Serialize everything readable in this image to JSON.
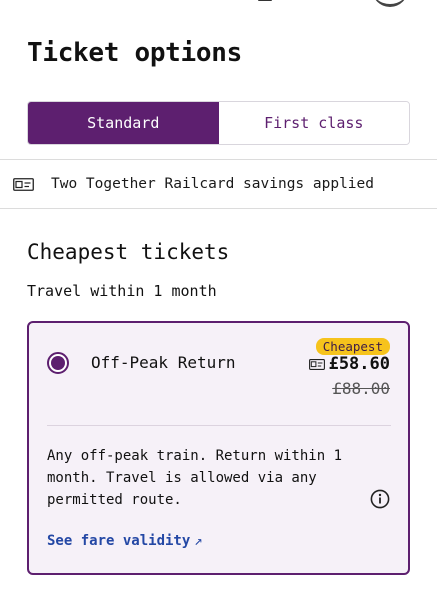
{
  "header": {
    "title": "Ticket options"
  },
  "class_toggle": {
    "options": [
      {
        "label": "Standard",
        "selected": true
      },
      {
        "label": "First class",
        "selected": false
      }
    ]
  },
  "railcard": {
    "icon": "railcard-icon",
    "text": "Two Together Railcard savings applied"
  },
  "section": {
    "title": "Cheapest tickets",
    "subtitle": "Travel within 1 month"
  },
  "ticket": {
    "selected": true,
    "name": "Off-Peak Return",
    "badge": "Cheapest",
    "price": "£58.60",
    "original_price": "£88.00",
    "description": "Any off-peak train. Return within 1 month. Travel is allowed via any permitted route.",
    "link_label": "See fare validity",
    "link_icon": "↗"
  },
  "colors": {
    "brand_purple": "#5d1f6f",
    "badge_yellow": "#f6c31c",
    "link_blue": "#2448a5",
    "card_bg": "#f6f1f8"
  }
}
